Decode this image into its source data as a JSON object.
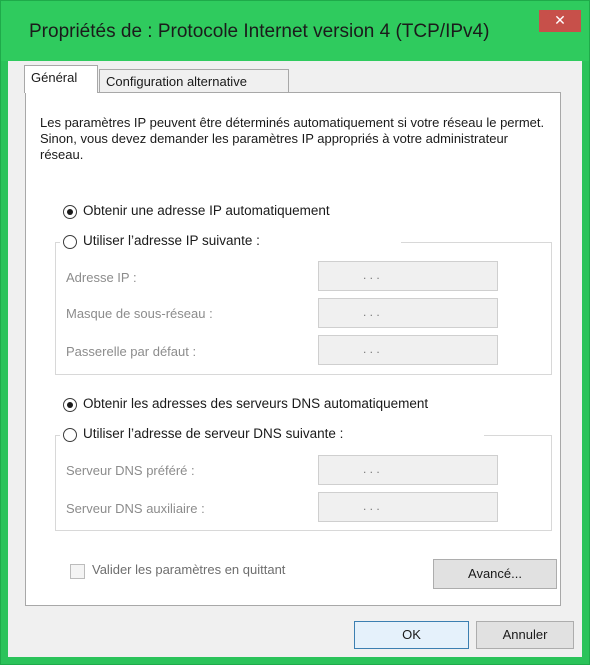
{
  "window": {
    "title": "Propriétés de : Protocole Internet version 4 (TCP/IPv4)",
    "close_glyph": "✕",
    "accent": "#2fcb5e"
  },
  "tabs": [
    {
      "label": "Général",
      "active": true
    },
    {
      "label": "Configuration alternative",
      "active": false
    }
  ],
  "intro_text": "Les paramètres IP peuvent être déterminés automatiquement si votre réseau le permet. Sinon, vous devez demander les paramètres IP appropriés à votre administrateur réseau.",
  "ip": {
    "auto_label": "Obtenir une adresse IP automatiquement",
    "auto_selected": true,
    "manual_label": "Utiliser l’adresse IP suivante :",
    "fields": [
      {
        "label": "Adresse IP :",
        "value": ". . ."
      },
      {
        "label": "Masque de sous-réseau :",
        "value": ". . ."
      },
      {
        "label": "Passerelle par défaut :",
        "value": ". . ."
      }
    ]
  },
  "dns": {
    "auto_label": "Obtenir les adresses des serveurs DNS automatiquement",
    "auto_selected": true,
    "manual_label": "Utiliser l’adresse de serveur DNS suivante :",
    "fields": [
      {
        "label": "Serveur DNS préféré :",
        "value": ". . ."
      },
      {
        "label": "Serveur DNS auxiliaire :",
        "value": ". . ."
      }
    ]
  },
  "validate_label": "Valider les paramètres en quittant",
  "validate_checked": false,
  "buttons": {
    "advanced": "Avancé...",
    "ok": "OK",
    "cancel": "Annuler"
  }
}
